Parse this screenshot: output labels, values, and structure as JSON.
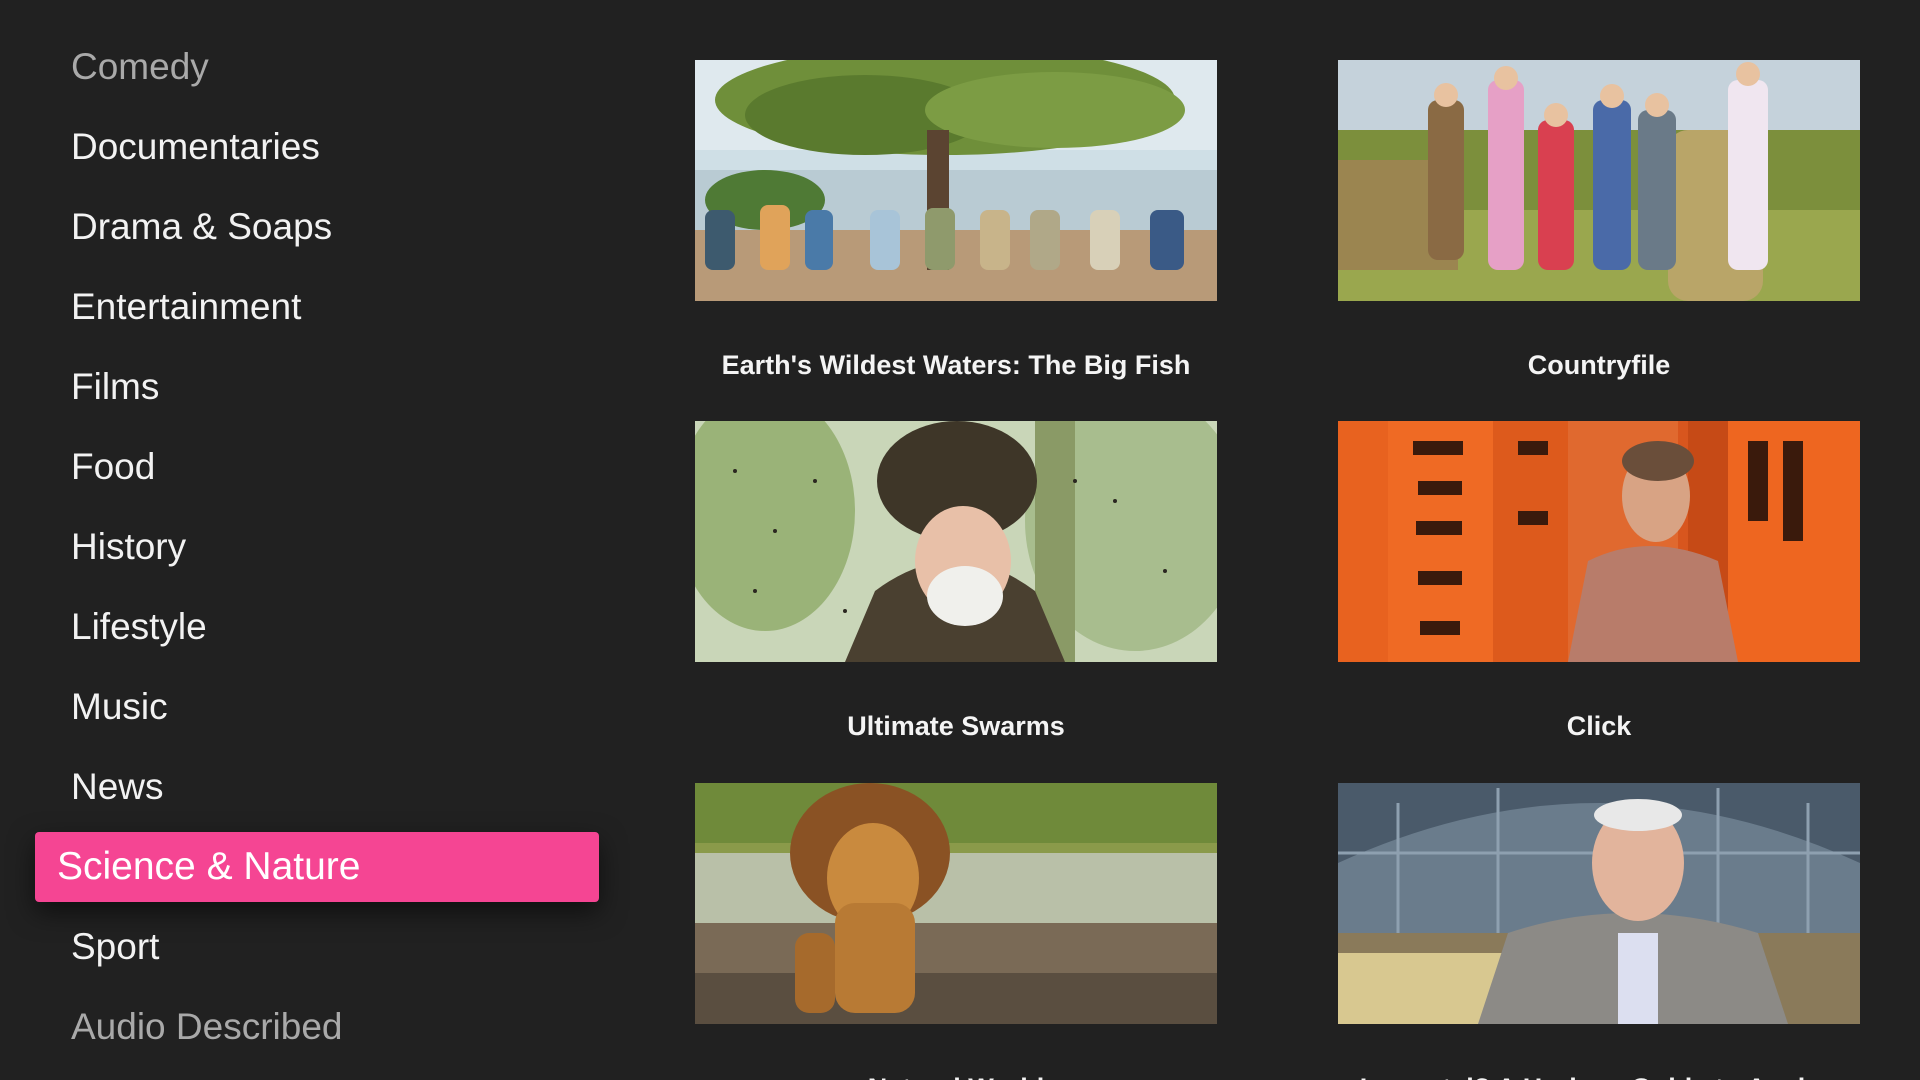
{
  "sidebar": {
    "items": [
      {
        "label": "Comedy"
      },
      {
        "label": "Documentaries"
      },
      {
        "label": "Drama & Soaps"
      },
      {
        "label": "Entertainment"
      },
      {
        "label": "Films"
      },
      {
        "label": "Food"
      },
      {
        "label": "History"
      },
      {
        "label": "Lifestyle"
      },
      {
        "label": "Music"
      },
      {
        "label": "News"
      },
      {
        "label": "Science & Nature",
        "selected": true
      },
      {
        "label": "Sport"
      },
      {
        "label": "Audio Described"
      }
    ]
  },
  "programmes": [
    {
      "title": "Earth's Wildest Waters: The Big Fish"
    },
    {
      "title": "Countryfile"
    },
    {
      "title": "Ultimate Swarms"
    },
    {
      "title": "Click"
    },
    {
      "title": "Natural World"
    },
    {
      "title": "Immortal? A Horizon Guide to Ageing"
    }
  ],
  "colors": {
    "background": "#212121",
    "accent": "#f54593",
    "text": "#f2f2f2",
    "text_faded": "#a9a9a9"
  }
}
